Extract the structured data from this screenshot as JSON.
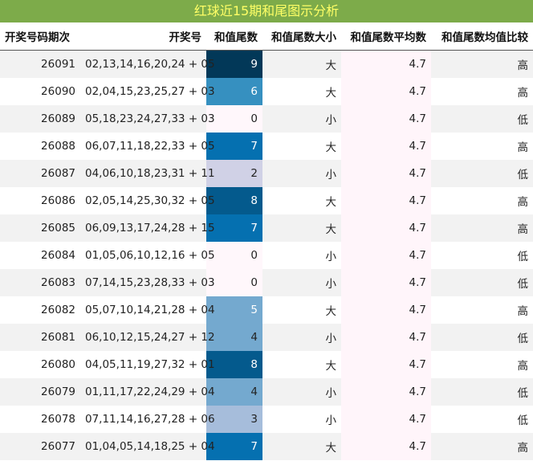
{
  "title": "红球近15期和尾图示分析",
  "headers": [
    "开奖号码期次",
    "开奖号",
    "和值尾数",
    "和值尾数大小",
    "和值尾数平均数",
    "和值尾数均值比较"
  ],
  "chart_data": {
    "type": "table",
    "title": "红球近15期和尾图示分析",
    "columns": [
      "开奖号码期次",
      "开奖号",
      "和值尾数",
      "和值尾数大小",
      "和值尾数平均数",
      "和值尾数均值比较"
    ],
    "heat_range": [
      0,
      9
    ],
    "heat_colors": [
      "#fff7fb",
      "#ece7f2",
      "#d0d1e6",
      "#a6bddb",
      "#74a9cf",
      "#3690c0",
      "#0570b0",
      "#045a8d",
      "#023858"
    ],
    "rows": [
      {
        "period": "26091",
        "numbers": "02,13,14,16,20,24 + 05",
        "tail": 9,
        "size": "大",
        "avg": "4.7",
        "compare": "高"
      },
      {
        "period": "26090",
        "numbers": "02,04,15,23,25,27 + 03",
        "tail": 6,
        "size": "大",
        "avg": "4.7",
        "compare": "高"
      },
      {
        "period": "26089",
        "numbers": "05,18,23,24,27,33 + 03",
        "tail": 0,
        "size": "小",
        "avg": "4.7",
        "compare": "低"
      },
      {
        "period": "26088",
        "numbers": "06,07,11,18,22,33 + 05",
        "tail": 7,
        "size": "大",
        "avg": "4.7",
        "compare": "高"
      },
      {
        "period": "26087",
        "numbers": "04,06,10,18,23,31 + 11",
        "tail": 2,
        "size": "小",
        "avg": "4.7",
        "compare": "低"
      },
      {
        "period": "26086",
        "numbers": "02,05,14,25,30,32 + 05",
        "tail": 8,
        "size": "大",
        "avg": "4.7",
        "compare": "高"
      },
      {
        "period": "26085",
        "numbers": "06,09,13,17,24,28 + 15",
        "tail": 7,
        "size": "大",
        "avg": "4.7",
        "compare": "高"
      },
      {
        "period": "26084",
        "numbers": "01,05,06,10,12,16 + 05",
        "tail": 0,
        "size": "小",
        "avg": "4.7",
        "compare": "低"
      },
      {
        "period": "26083",
        "numbers": "07,14,15,23,28,33 + 03",
        "tail": 0,
        "size": "小",
        "avg": "4.7",
        "compare": "低"
      },
      {
        "period": "26082",
        "numbers": "05,07,10,14,21,28 + 04",
        "tail": 5,
        "size": "大",
        "avg": "4.7",
        "compare": "高"
      },
      {
        "period": "26081",
        "numbers": "06,10,12,15,24,27 + 12",
        "tail": 4,
        "size": "小",
        "avg": "4.7",
        "compare": "低"
      },
      {
        "period": "26080",
        "numbers": "04,05,11,19,27,32 + 01",
        "tail": 8,
        "size": "大",
        "avg": "4.7",
        "compare": "高"
      },
      {
        "period": "26079",
        "numbers": "01,11,17,22,24,29 + 04",
        "tail": 4,
        "size": "小",
        "avg": "4.7",
        "compare": "低"
      },
      {
        "period": "26078",
        "numbers": "07,11,14,16,27,28 + 06",
        "tail": 3,
        "size": "小",
        "avg": "4.7",
        "compare": "低"
      },
      {
        "period": "26077",
        "numbers": "01,04,05,14,18,25 + 04",
        "tail": 7,
        "size": "大",
        "avg": "4.7",
        "compare": "高"
      }
    ]
  }
}
